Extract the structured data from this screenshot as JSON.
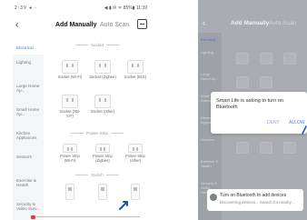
{
  "left": {
    "status": {
      "left": "2:39 ● ◦",
      "right": "◀ ▮ ✉ ᯤ 85%▮ 11:39"
    },
    "header": {
      "tab_active": "Add Manually",
      "tab_inactive": "Auto Scan"
    },
    "side_nav": [
      "Electrical",
      "Lighting",
      "Large Home Ap...",
      "Small Home Ap...",
      "Kitchen Appliances",
      "Sensors",
      "Exercise & Health",
      "Security & Video Surv..."
    ],
    "sections": {
      "socket": "Socket",
      "power_strip": "Power Strip"
    },
    "devices": [
      {
        "label": "Socket (Wi-Fi)"
      },
      {
        "label": "Socket (Zigbee)"
      },
      {
        "label": "Socket (BLE)"
      },
      {
        "label": "Socket (NB-IoT)"
      },
      {
        "label": "Socket (other)"
      },
      {
        "label": "Power Strip (Wi-Fi)"
      },
      {
        "label": "Power Strip (Zigbee)"
      },
      {
        "label": "Power Strip (other)"
      }
    ],
    "switch_label": "Switch"
  },
  "right": {
    "header": {
      "tab_active": "Add Manually",
      "tab_inactive": "Auto Scan"
    },
    "side_nav": [
      "Electrical",
      "Lighting",
      "Large Home Ap...",
      "Small Home Ap...",
      "Kitchen Appliances",
      "Sensors",
      "Exercise & Health",
      "Security & Video Surv..."
    ],
    "dialog": {
      "message": "Smart Life is asking to turn on Bluetooth",
      "deny": "DENY",
      "allow": "ALLOW"
    },
    "toast": {
      "line1": "Turn on Bluetooth to add devices",
      "line2": "Discovering devices... Search for nearby..."
    }
  }
}
